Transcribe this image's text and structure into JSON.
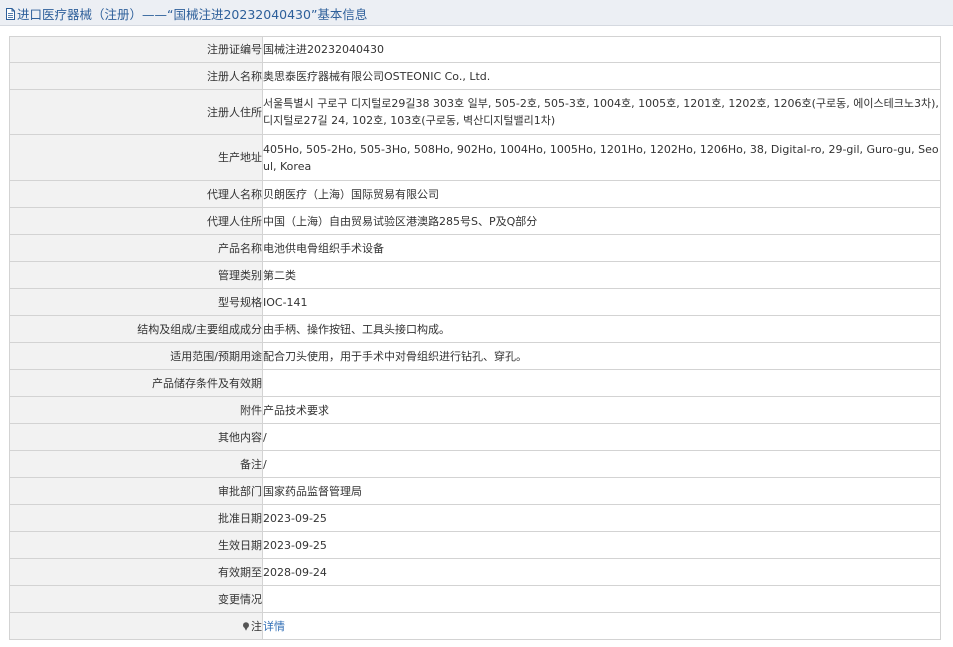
{
  "title": "进口医疗器械（注册）——“国械注进20232040430”基本信息",
  "rows": [
    {
      "label": "注册证编号",
      "value": "国械注进20232040430"
    },
    {
      "label": "注册人名称",
      "value": "奥思泰医疗器械有限公司OSTEONIC Co., Ltd."
    },
    {
      "label": "注册人住所",
      "value": "서울특별시 구로구 디지털로29길38 303호 일부, 505-2호, 505-3호, 1004호, 1005호, 1201호, 1202호, 1206호(구로동, 에이스테크노3차), 디지털로27길 24, 102호, 103호(구로동, 벽산디지털밸리1차)"
    },
    {
      "label": "生产地址",
      "value": "405Ho, 505-2Ho, 505-3Ho, 508Ho, 902Ho, 1004Ho, 1005Ho, 1201Ho, 1202Ho, 1206Ho, 38, Digital-ro, 29-gil, Guro-gu, Seoul, Korea"
    },
    {
      "label": "代理人名称",
      "value": "贝朗医疗（上海）国际贸易有限公司"
    },
    {
      "label": "代理人住所",
      "value": "中国（上海）自由贸易试验区港澳路285号S、P及Q部分"
    },
    {
      "label": "产品名称",
      "value": "电池供电骨组织手术设备"
    },
    {
      "label": "管理类别",
      "value": "第二类"
    },
    {
      "label": "型号规格",
      "value": "IOC-141"
    },
    {
      "label": "结构及组成/主要组成成分",
      "value": "由手柄、操作按钮、工具头接口构成。"
    },
    {
      "label": "适用范围/预期用途",
      "value": "配合刀头使用，用于手术中对骨组织进行钻孔、穿孔。"
    },
    {
      "label": "产品储存条件及有效期",
      "value": ""
    },
    {
      "label": "附件",
      "value": "产品技术要求"
    },
    {
      "label": "其他内容",
      "value": "/"
    },
    {
      "label": "备注",
      "value": "/"
    },
    {
      "label": "审批部门",
      "value": "国家药品监督管理局"
    },
    {
      "label": "批准日期",
      "value": "2023-09-25"
    },
    {
      "label": "生效日期",
      "value": "2023-09-25"
    },
    {
      "label": "有效期至",
      "value": "2028-09-24"
    },
    {
      "label": "变更情况",
      "value": ""
    }
  ],
  "note_row": {
    "label": "注",
    "link_text": "详情",
    "icon": "pin-icon"
  },
  "colors": {
    "title": "#2d5f9a",
    "link": "#2f6db5",
    "label_bg": "#f2f2f2",
    "border": "#d3d3d3"
  }
}
